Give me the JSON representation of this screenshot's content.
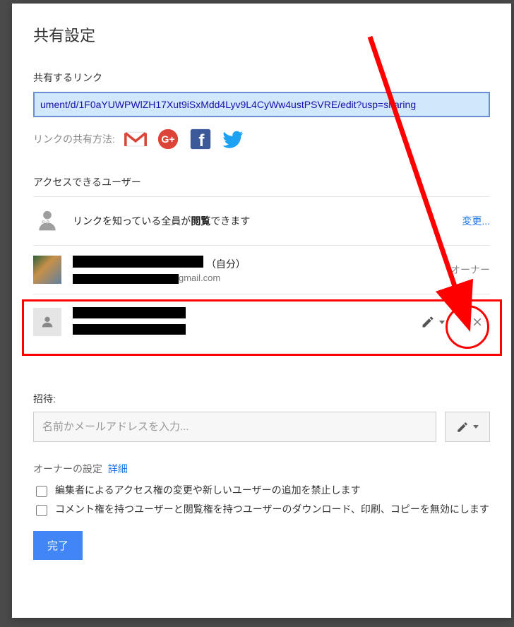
{
  "dialog": {
    "title": "共有設定",
    "link_section_label": "共有するリンク",
    "share_url": "ument/d/1F0aYUWPWlZH17Xut9iSxMdd4Lyv9L4CyWw4ustPSVRE/edit?usp=sharing",
    "share_via_label": "リンクの共有方法:",
    "access_section_label": "アクセスできるユーザー",
    "access_row_public": {
      "text_prefix": "リンクを知っている全員が",
      "text_bold": "閲覧",
      "text_suffix": "できます",
      "change_label": "変更..."
    },
    "owner_row": {
      "self_suffix": "（自分）",
      "email_suffix": "gmail.com",
      "role": "オーナー"
    },
    "invite": {
      "label": "招待:",
      "placeholder": "名前かメールアドレスを入力..."
    },
    "owner_settings": {
      "prefix": "オーナーの設定",
      "details": "詳細"
    },
    "checkbox1": "編集者によるアクセス権の変更や新しいユーザーの追加を禁止します",
    "checkbox2": "コメント権を持つユーザーと閲覧権を持つユーザーのダウンロード、印刷、コピーを無効にします",
    "done_label": "完了"
  },
  "social": [
    {
      "name": "gmail"
    },
    {
      "name": "google-plus"
    },
    {
      "name": "facebook"
    },
    {
      "name": "twitter"
    }
  ]
}
